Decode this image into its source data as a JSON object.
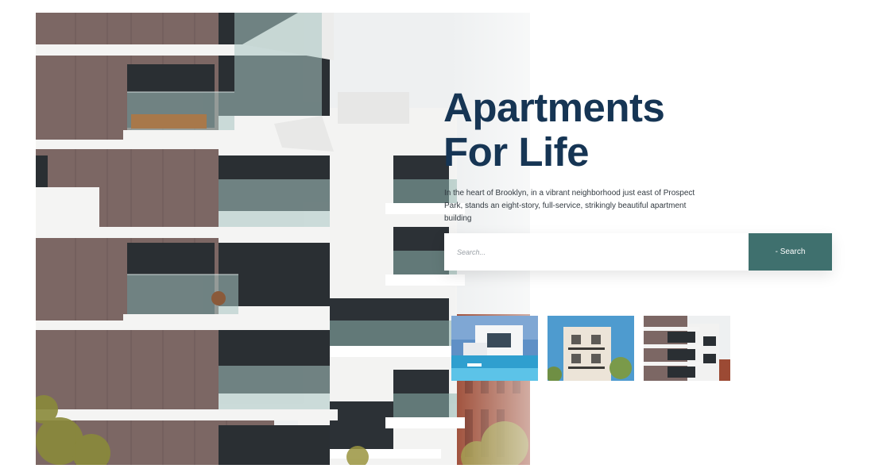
{
  "hero": {
    "headline_line1": "Apartments",
    "headline_line2": "For Life",
    "description": "In the heart of Brooklyn, in a vibrant neighborhood just east of Prospect Park, stands an eight-story, full-service, strikingly beautiful apartment building"
  },
  "search": {
    "placeholder": "Search...",
    "button_label": "- Search"
  },
  "thumbnails": [
    {
      "name": "villa-with-pool"
    },
    {
      "name": "balcony-building"
    },
    {
      "name": "modern-apartments"
    }
  ],
  "colors": {
    "headline": "#163554",
    "accent": "#3f706e",
    "facade": "#7c6764"
  }
}
